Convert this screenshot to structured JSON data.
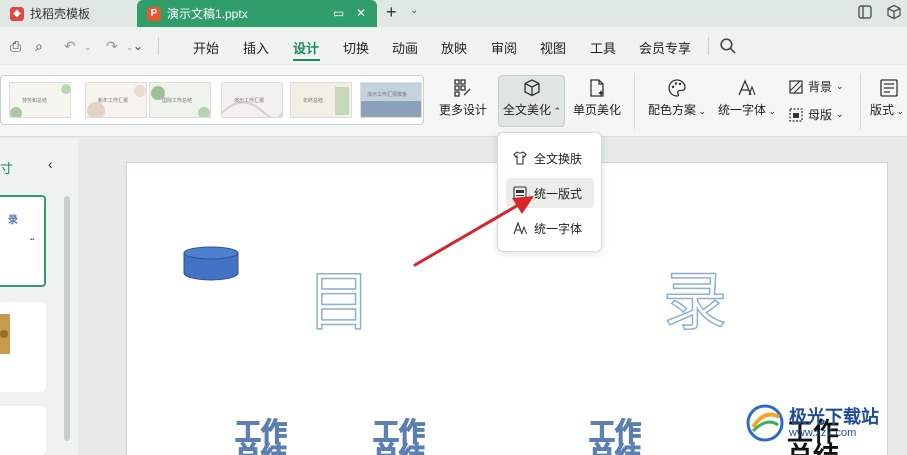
{
  "tabs": [
    {
      "label": "找稻壳模板",
      "icon": "docer-logo-icon"
    },
    {
      "label": "演示文稿1.pptx",
      "icon": "ppt-file-icon"
    }
  ],
  "menu": [
    "开始",
    "插入",
    "设计",
    "切换",
    "动画",
    "放映",
    "审阅",
    "视图",
    "工具",
    "会员专享"
  ],
  "active_menu": "设计",
  "gallery_thumbs": [
    "劳务和总结",
    "新年工作汇报",
    "国际工作总结",
    "演示工作汇报",
    "年终总结",
    "演示工作汇报模板"
  ],
  "ribbon": {
    "more_design": "更多设计",
    "full_beautify": "全文美化",
    "page_beautify": "单页美化",
    "color_scheme": "配色方案",
    "unify_font": "统一字体",
    "background": "背景",
    "master": "母版",
    "layout": "版式"
  },
  "dropdown": {
    "items": [
      "全文换肤",
      "统一版式",
      "统一字体"
    ],
    "hovered": "统一版式"
  },
  "left_panel": {
    "title_partial": "寸",
    "slide1_text": "录"
  },
  "slide": {
    "char1": "目",
    "char2": "录",
    "sub1": "工作\n总结",
    "sub2": "工作\n总结",
    "sub3": "工作\n总结",
    "sub4": "工作\n总结"
  },
  "watermark": {
    "name": "极光下载站",
    "url": "www.xz7.com"
  },
  "colors": {
    "accent": "#2f9e6a",
    "arrow": "#d9232a",
    "shape_fill": "#4472c4"
  }
}
